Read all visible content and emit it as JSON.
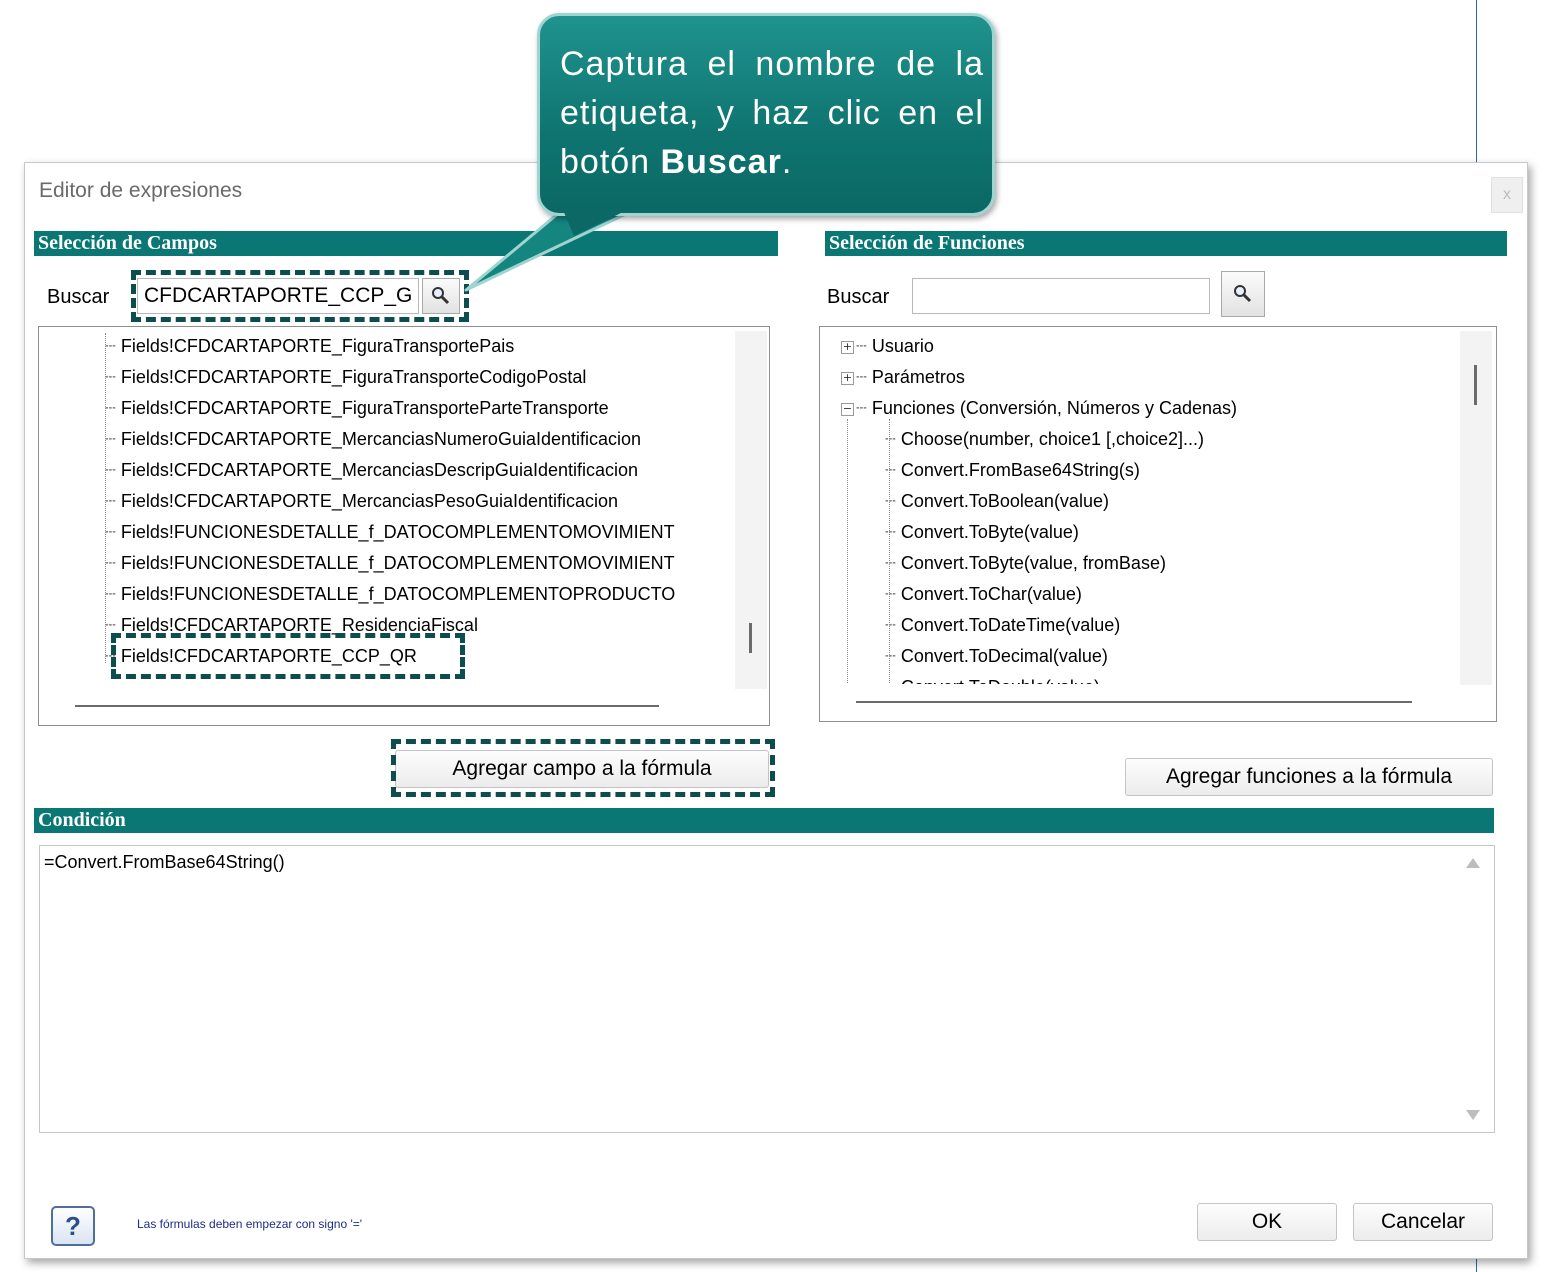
{
  "dialog": {
    "title": "Editor de expresiones",
    "close_label": "x"
  },
  "fields_section": {
    "header": "Selección de Campos",
    "search_label": "Buscar",
    "search_value": "CFDCARTAPORTE_CCP_G",
    "items": [
      "Fields!CFDCARTAPORTE_FiguraTransportePais",
      "Fields!CFDCARTAPORTE_FiguraTransporteCodigoPostal",
      "Fields!CFDCARTAPORTE_FiguraTransporteParteTransporte",
      "Fields!CFDCARTAPORTE_MercanciasNumeroGuiaIdentificacion",
      "Fields!CFDCARTAPORTE_MercanciasDescripGuiaIdentificacion",
      "Fields!CFDCARTAPORTE_MercanciasPesoGuiaIdentificacion",
      "Fields!FUNCIONESDETALLE_f_DATOCOMPLEMENTOMOVIMIENT",
      "Fields!FUNCIONESDETALLE_f_DATOCOMPLEMENTOMOVIMIENT",
      "Fields!FUNCIONESDETALLE_f_DATOCOMPLEMENTOPRODUCTO",
      "Fields!CFDCARTAPORTE_ResidenciaFiscal",
      "Fields!CFDCARTAPORTE_CCP_QR"
    ],
    "add_button": "Agregar campo a la fórmula"
  },
  "functions_section": {
    "header": "Selección de Funciones",
    "search_label": "Buscar",
    "search_value": "",
    "groups": [
      {
        "expander": "+",
        "label": "Usuario"
      },
      {
        "expander": "+",
        "label": "Parámetros"
      },
      {
        "expander": "−",
        "label": "Funciones (Conversión, Números y Cadenas)"
      }
    ],
    "items": [
      "Choose(number, choice1 [,choice2]...)",
      "Convert.FromBase64String(s)",
      "Convert.ToBoolean(value)",
      "Convert.ToByte(value)",
      "Convert.ToByte(value, fromBase)",
      "Convert.ToChar(value)",
      "Convert.ToDateTime(value)",
      "Convert.ToDecimal(value)",
      "Convert.ToDouble(value)"
    ],
    "add_button": "Agregar funciones a la fórmula"
  },
  "condition_section": {
    "header": "Condición",
    "formula": "=Convert.FromBase64String()"
  },
  "footer": {
    "help_icon": "?",
    "help_text": "Las fórmulas deben empezar con signo '='",
    "ok_button": "OK",
    "cancel_button": "Cancelar"
  },
  "callout": {
    "text_before": "Captura el nombre de la etiqueta, y haz clic en el botón ",
    "text_bold": "Buscar",
    "text_after": "."
  },
  "colors": {
    "section_header": "#0b7774",
    "callout": "#0f7470",
    "dashed_highlight": "#0e4d4d"
  },
  "icons": {
    "search": "magnifier-icon",
    "help": "question-icon"
  }
}
